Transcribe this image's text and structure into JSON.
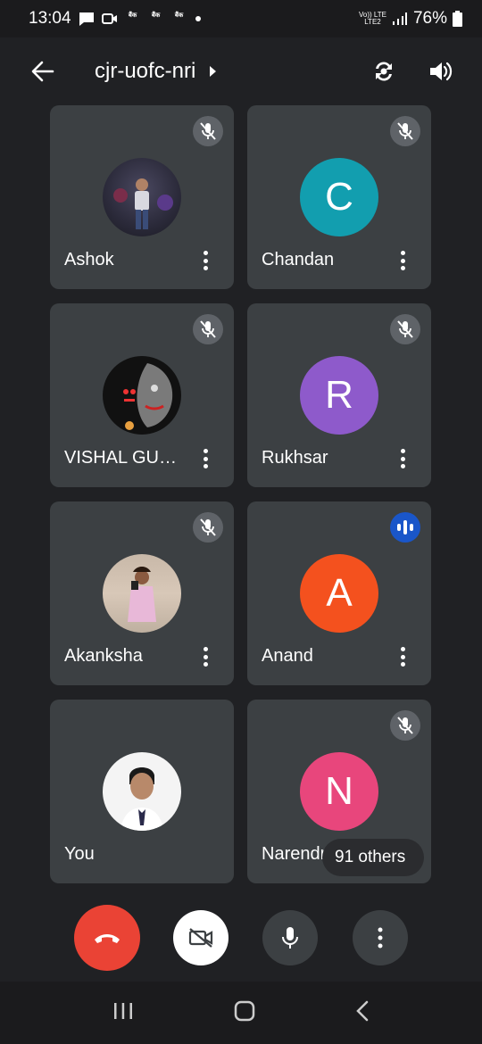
{
  "status": {
    "time": "13:04",
    "notif_labels": [
      "बैंक",
      "बैंक",
      "बैंक"
    ],
    "network": "Vo)) LTE\nLTE2",
    "battery": "76%"
  },
  "header": {
    "title": "cjr-uofc-nri"
  },
  "participants": [
    {
      "name": "Ashok",
      "avatar_type": "photo",
      "state": "muted"
    },
    {
      "name": "Chandan",
      "initial": "C",
      "color": "#129eaf",
      "state": "muted"
    },
    {
      "name": "VISHAL GU…",
      "avatar_type": "photo",
      "state": "muted"
    },
    {
      "name": "Rukhsar",
      "initial": "R",
      "color": "#8e5acb",
      "state": "muted"
    },
    {
      "name": "Akanksha",
      "avatar_type": "photo",
      "state": "muted"
    },
    {
      "name": "Anand",
      "initial": "A",
      "color": "#f4511e",
      "state": "speaking"
    },
    {
      "name": "You",
      "avatar_type": "photo",
      "state": "none"
    },
    {
      "name": "Narendra K…",
      "initial": "N",
      "color": "#e8467c",
      "state": "muted"
    }
  ],
  "others_chip": "91 others",
  "colors": {
    "end_call": "#ea4335",
    "tile_bg": "#3c4043",
    "speaking": "#1a56c9"
  }
}
